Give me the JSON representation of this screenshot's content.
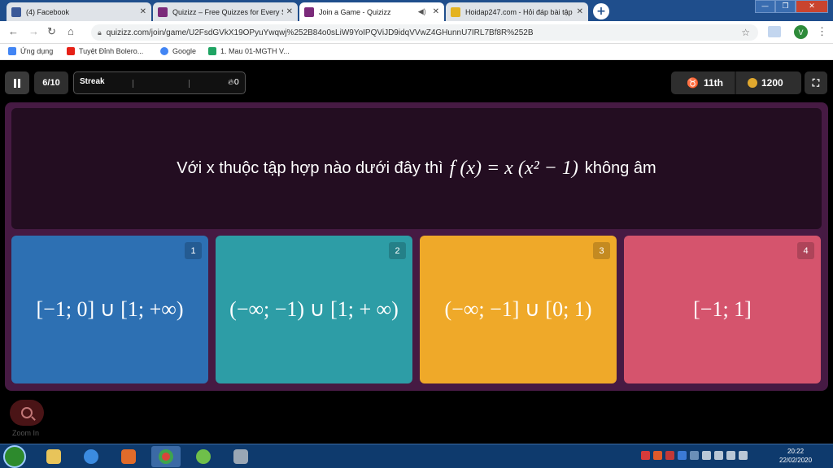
{
  "browser": {
    "tabs": [
      {
        "title": "(4) Facebook",
        "icon": "facebook-icon",
        "color": "#3b5998",
        "active": false
      },
      {
        "title": "Quizizz – Free Quizzes for Every S",
        "icon": "quizizz-icon",
        "color": "#7b2a7a",
        "active": false
      },
      {
        "title": "Join a Game - Quizizz",
        "icon": "quizizz-icon",
        "color": "#7b2a7a",
        "active": true
      },
      {
        "title": "Hoidap247.com - Hỏi đáp bài tập",
        "icon": "hoidap-icon",
        "color": "#e4b321",
        "active": false
      }
    ],
    "new_tab": "+",
    "url": "quizizz.com/join/game/U2FsdGVkX19OPyuYwqwj%252B84o0sLiW9YoIPQViJD9idqVVwZ4GHunnU7IRL7Bf8R%252B",
    "profile_initial": "V",
    "bookmarks": [
      {
        "label": "Ứng dụng",
        "icon": "apps-icon",
        "color": "#4285f4"
      },
      {
        "label": "Tuyệt Đỉnh Bolero...",
        "icon": "youtube-icon",
        "color": "#e62117"
      },
      {
        "label": "Google",
        "icon": "google-icon",
        "color": "#4285f4"
      },
      {
        "label": "1. Mau 01-MGTH V...",
        "icon": "drive-icon",
        "color": "#1fa463"
      }
    ]
  },
  "game": {
    "progress": "6/10",
    "streak_label": "Streak",
    "streak_count": "0",
    "rank": "11th",
    "score": "1200",
    "question_prefix": "Với x thuộc tập hợp nào dưới đây thì",
    "question_math": "f (x) = x (x² − 1)",
    "question_suffix": "không âm",
    "options": [
      {
        "number": "1",
        "text": "[−1; 0] ∪ [1; +∞)",
        "color": "#2d70b3"
      },
      {
        "number": "2",
        "text": "(−∞; −1) ∪ [1; + ∞)",
        "color": "#2d9da6"
      },
      {
        "number": "3",
        "text": "(−∞; −1] ∪ [0; 1)",
        "color": "#efa929"
      },
      {
        "number": "4",
        "text": "[−1; 1]",
        "color": "#d5546d"
      }
    ],
    "zoom_label": "Zoom In"
  },
  "taskbar": {
    "time": "20:22",
    "date": "22/02/2020"
  }
}
